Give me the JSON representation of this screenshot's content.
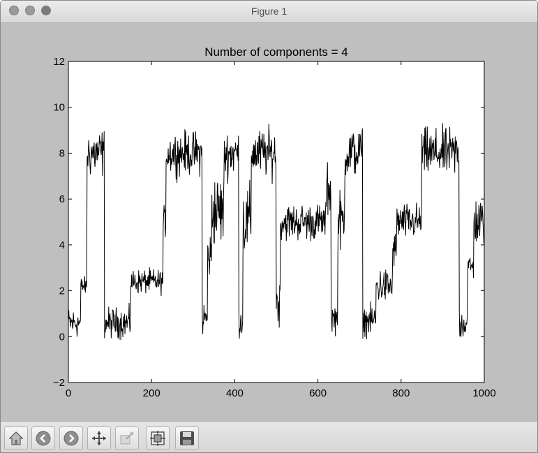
{
  "window": {
    "title": "Figure 1"
  },
  "toolbar": {
    "buttons": [
      "home",
      "back",
      "forward",
      "pan",
      "zoom",
      "subplots",
      "save"
    ]
  },
  "chart_data": {
    "type": "line",
    "title": "Number of components = 4",
    "xlabel": "",
    "ylabel": "",
    "xlim": [
      0,
      1000
    ],
    "ylim": [
      -2,
      12
    ],
    "xticks": [
      0,
      200,
      400,
      600,
      800,
      1000
    ],
    "xtick_labels": [
      "0",
      "200",
      "400",
      "600",
      "800",
      "1000"
    ],
    "yticks": [
      -2,
      0,
      2,
      4,
      6,
      8,
      10,
      12
    ],
    "ytick_labels": [
      "−2",
      "0",
      "2",
      "4",
      "6",
      "8",
      "10",
      "12"
    ],
    "line_color": "#000000",
    "grid": false,
    "series": [
      {
        "segments": [
          {
            "x0": 0,
            "x1": 30,
            "mean": 0.6,
            "noise": 0.5
          },
          {
            "x0": 30,
            "x1": 45,
            "mean": 2.2,
            "noise": 0.3
          },
          {
            "x0": 45,
            "x1": 87,
            "mean": 8.0,
            "noise": 0.8
          },
          {
            "x0": 87,
            "x1": 150,
            "mean": 0.6,
            "noise": 0.5
          },
          {
            "x0": 150,
            "x1": 228,
            "mean": 2.4,
            "noise": 0.4
          },
          {
            "x0": 228,
            "x1": 235,
            "mean": 5.0,
            "noise": 0.5
          },
          {
            "x0": 235,
            "x1": 322,
            "mean": 8.0,
            "noise": 0.7
          },
          {
            "x0": 322,
            "x1": 335,
            "mean": 0.8,
            "noise": 0.6
          },
          {
            "x0": 335,
            "x1": 345,
            "mean": 3.5,
            "noise": 0.8
          },
          {
            "x0": 345,
            "x1": 375,
            "mean": 5.5,
            "noise": 1.2
          },
          {
            "x0": 375,
            "x1": 410,
            "mean": 8.0,
            "noise": 0.8
          },
          {
            "x0": 410,
            "x1": 420,
            "mean": 0.7,
            "noise": 0.5
          },
          {
            "x0": 420,
            "x1": 440,
            "mean": 5.0,
            "noise": 1.2
          },
          {
            "x0": 440,
            "x1": 500,
            "mean": 8.0,
            "noise": 0.8
          },
          {
            "x0": 500,
            "x1": 510,
            "mean": 1.5,
            "noise": 0.8
          },
          {
            "x0": 510,
            "x1": 620,
            "mean": 5.0,
            "noise": 0.6
          },
          {
            "x0": 620,
            "x1": 632,
            "mean": 6.5,
            "noise": 1.0
          },
          {
            "x0": 632,
            "x1": 648,
            "mean": 0.8,
            "noise": 0.5
          },
          {
            "x0": 648,
            "x1": 665,
            "mean": 5.0,
            "noise": 1.0
          },
          {
            "x0": 665,
            "x1": 708,
            "mean": 8.0,
            "noise": 0.8
          },
          {
            "x0": 708,
            "x1": 740,
            "mean": 0.7,
            "noise": 0.5
          },
          {
            "x0": 740,
            "x1": 780,
            "mean": 2.2,
            "noise": 0.6
          },
          {
            "x0": 780,
            "x1": 790,
            "mean": 3.8,
            "noise": 0.6
          },
          {
            "x0": 790,
            "x1": 850,
            "mean": 5.0,
            "noise": 0.6
          },
          {
            "x0": 850,
            "x1": 940,
            "mean": 8.0,
            "noise": 0.8
          },
          {
            "x0": 940,
            "x1": 960,
            "mean": 0.6,
            "noise": 0.6
          },
          {
            "x0": 960,
            "x1": 975,
            "mean": 3.0,
            "noise": 0.5
          },
          {
            "x0": 975,
            "x1": 1000,
            "mean": 5.0,
            "noise": 0.8
          }
        ]
      }
    ]
  }
}
